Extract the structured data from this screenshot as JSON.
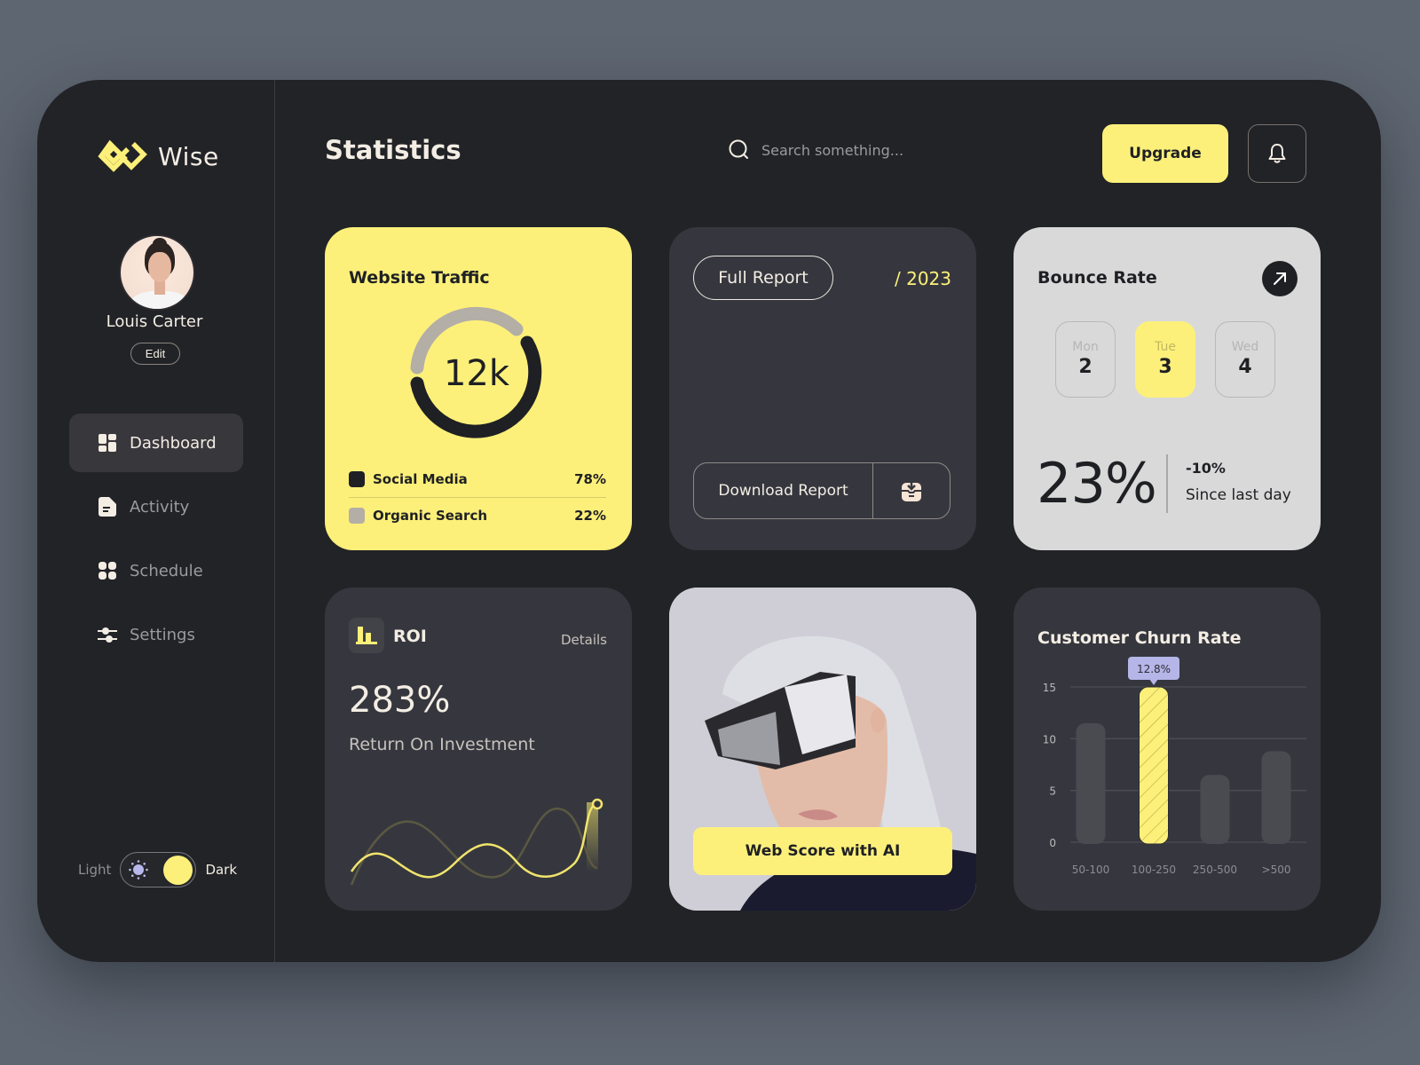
{
  "app": {
    "brand": "Wise",
    "accent": "#fdf07a"
  },
  "user": {
    "name": "Louis Carter",
    "edit_label": "Edit"
  },
  "sidebar": {
    "items": [
      {
        "label": "Dashboard",
        "icon": "dashboard-icon",
        "active": true
      },
      {
        "label": "Activity",
        "icon": "document-icon",
        "active": false
      },
      {
        "label": "Schedule",
        "icon": "grid-icon",
        "active": false
      },
      {
        "label": "Settings",
        "icon": "sliders-icon",
        "active": false
      }
    ],
    "theme": {
      "light_label": "Light",
      "dark_label": "Dark",
      "selected": "Dark"
    }
  },
  "header": {
    "title": "Statistics",
    "search_placeholder": "Search something...",
    "search_value": "",
    "upgrade_label": "Upgrade"
  },
  "traffic": {
    "title": "Website Traffic",
    "total": "12k",
    "segments": [
      {
        "label": "Social Media",
        "value": "78%",
        "color": "#1f2024"
      },
      {
        "label": "Organic Search",
        "value": "22%",
        "color": "#b3aea6"
      }
    ]
  },
  "report": {
    "full_report_label": "Full Report",
    "year": "/ 2023",
    "download_label": "Download Report"
  },
  "bounce": {
    "title": "Bounce Rate",
    "days": [
      {
        "name": "Mon",
        "num": "2",
        "active": false
      },
      {
        "name": "Tue",
        "num": "3",
        "active": true
      },
      {
        "name": "Wed",
        "num": "4",
        "active": false
      }
    ],
    "value": "23%",
    "change": "-10%",
    "change_label": "Since last day"
  },
  "roi": {
    "title": "ROI",
    "details_label": "Details",
    "value": "283%",
    "subtitle": "Return On Investment"
  },
  "ai": {
    "button_label": "Web Score with AI"
  },
  "chart_data": {
    "type": "bar",
    "title": "Customer Churn Rate",
    "categories": [
      "50-100",
      "100-250",
      "250-500",
      ">500"
    ],
    "values": [
      11.5,
      15,
      6.5,
      8.8
    ],
    "highlight_index": 1,
    "highlight_label": "12.8%",
    "yticks": [
      0,
      5,
      10,
      15
    ],
    "ylim": [
      0,
      15
    ],
    "xlabel": "",
    "ylabel": "",
    "grid": true
  }
}
